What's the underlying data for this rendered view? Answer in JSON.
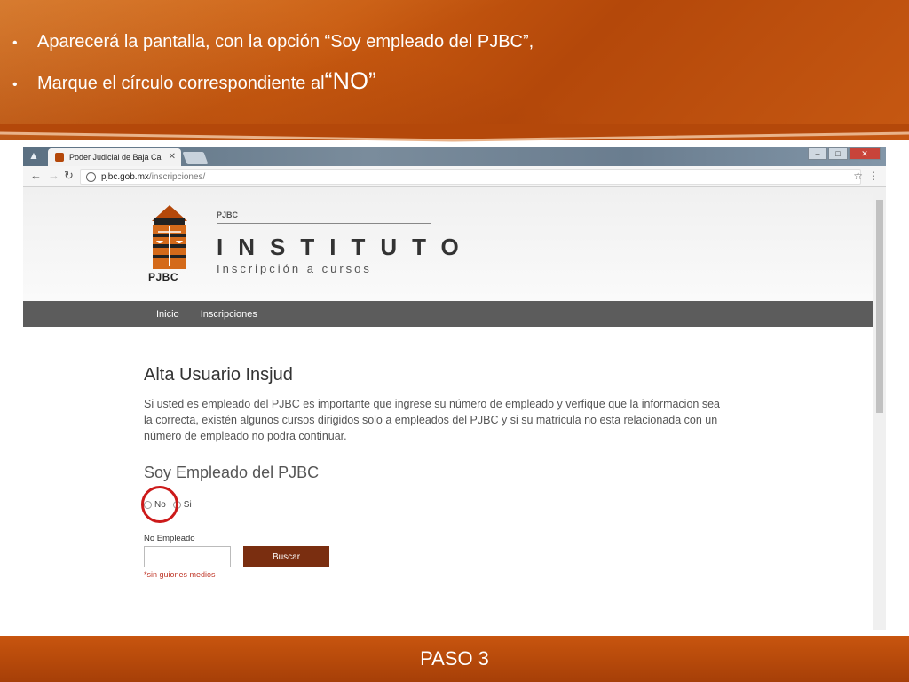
{
  "slide": {
    "bullets": [
      {
        "text": "Aparecerá la pantalla, con la opción “Soy empleado del PJBC”,"
      },
      {
        "text": "Marque el círculo correspondiente al ",
        "emphasis": "“NO”"
      }
    ],
    "footer": "PASO 3",
    "colors": {
      "accent": "#c8550f",
      "highlight_ring": "#cc1a1a"
    }
  },
  "browser": {
    "tab_title": "Poder Judicial de Baja Ca",
    "url_host": "pjbc.gob.mx",
    "url_path": "/inscripciones/",
    "icons": [
      "back-icon",
      "forward-icon",
      "reload-icon",
      "info-icon",
      "star-icon",
      "menu-icon"
    ]
  },
  "site": {
    "logo_text": "PJBC",
    "brand_small": "PJBC",
    "brand_title": "INSTITUTO",
    "brand_subtitle": "Inscripción a cursos",
    "nav": [
      "Inicio",
      "Inscripciones"
    ]
  },
  "form": {
    "title": "Alta Usuario Insjud",
    "description": "Si usted es empleado del PJBC es importante que ingrese su número de empleado y verfique que la informacion sea la correcta, existén algunos cursos dirigidos solo a empleados del PJBC y si su matricula no esta relacionada con un número de empleado no podra continuar.",
    "subtitle": "Soy Empleado del PJBC",
    "options": [
      "No",
      "Si"
    ],
    "employee_label": "No Empleado",
    "employee_value": "",
    "search_label": "Buscar",
    "hint": "*sin guiones medios"
  }
}
